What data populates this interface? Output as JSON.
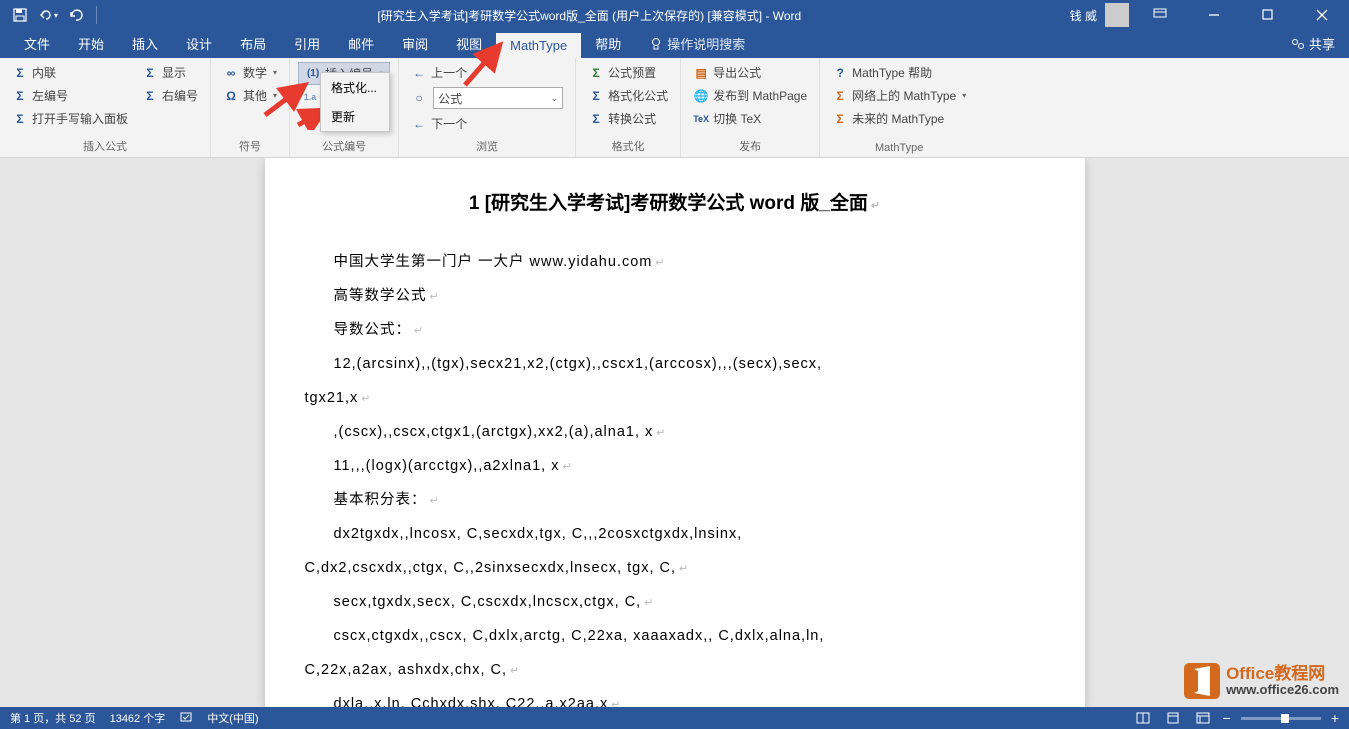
{
  "titlebar": {
    "title": "[研究生入学考试]考研数学公式word版_全面 (用户上次保存的) [兼容模式]  -  Word",
    "user": "钱 威"
  },
  "tabs": {
    "file": "文件",
    "home": "开始",
    "insert": "插入",
    "design": "设计",
    "layout": "布局",
    "references": "引用",
    "mailings": "邮件",
    "review": "审阅",
    "view": "视图",
    "mathtype": "MathType",
    "help": "帮助",
    "tellme": "操作说明搜索",
    "share": "共享"
  },
  "ribbon": {
    "g1": {
      "inline": "内联",
      "left": "左编号",
      "open": "打开手写输入面板",
      "show": "显示",
      "right": "右编号",
      "label": "插入公式"
    },
    "g2": {
      "math": "数学",
      "other": "其他",
      "label": "符号"
    },
    "g3": {
      "insertnum": "插入编号",
      "label": "公式编号"
    },
    "dropdown": {
      "format": "格式化...",
      "update": "更新"
    },
    "g4": {
      "prev": "上一个",
      "combo": "公式",
      "next": "下一个",
      "label": "浏览"
    },
    "g5": {
      "preset": "公式预置",
      "format": "格式化公式",
      "convert": "转换公式",
      "label": "格式化"
    },
    "g6": {
      "export": "导出公式",
      "publish": "发布到 MathPage",
      "tex": "切换 TeX",
      "label": "发布"
    },
    "g7": {
      "help": "MathType 帮助",
      "online": "网络上的 MathType",
      "future": "未来的 MathType",
      "label": "MathType"
    }
  },
  "doc": {
    "title": "1 [研究生入学考试]考研数学公式 word 版_全面",
    "p1": "中国大学生第一门户 一大户 www.yidahu.com",
    "p2": "高等数学公式",
    "p3": "导数公式：",
    "p4": "12,(arcsinx),,(tgx),secx21,x2,(ctgx),,cscx1,(arccosx),,,(secx),secx,",
    "p5": "tgx21,x",
    "p6": ",(cscx),,cscx,ctgx1,(arctgx),xx2,(a),alna1, x",
    "p7": "11,,,(logx)(arcctgx),,a2xlna1, x",
    "p8": "基本积分表：",
    "p9": "dx2tgxdx,,lncosx, C,secxdx,tgx, C,,,2cosxctgxdx,lnsinx,",
    "p10": "C,dx2,cscxdx,,ctgx, C,,2sinxsecxdx,lnsecx, tgx, C,",
    "p11": "secx,tgxdx,secx, C,cscxdx,lncscx,ctgx, C,",
    "p12": "cscx,ctgxdx,,cscx, C,dxlx,arctg, C,22xa, xaaaxadx,, C,dxlx,alna,ln,",
    "p13": "C,22x,a2ax, ashxdx,chx, C,",
    "p14": "dxla,,x,ln, Cchxdx,shx, C22,,a,x2aa,x"
  },
  "status": {
    "page": "第 1 页，共 52 页",
    "words": "13462 个字",
    "lang": "中文(中国)"
  },
  "watermark": {
    "l1": "Office教程网",
    "l2": "www.office26.com"
  }
}
